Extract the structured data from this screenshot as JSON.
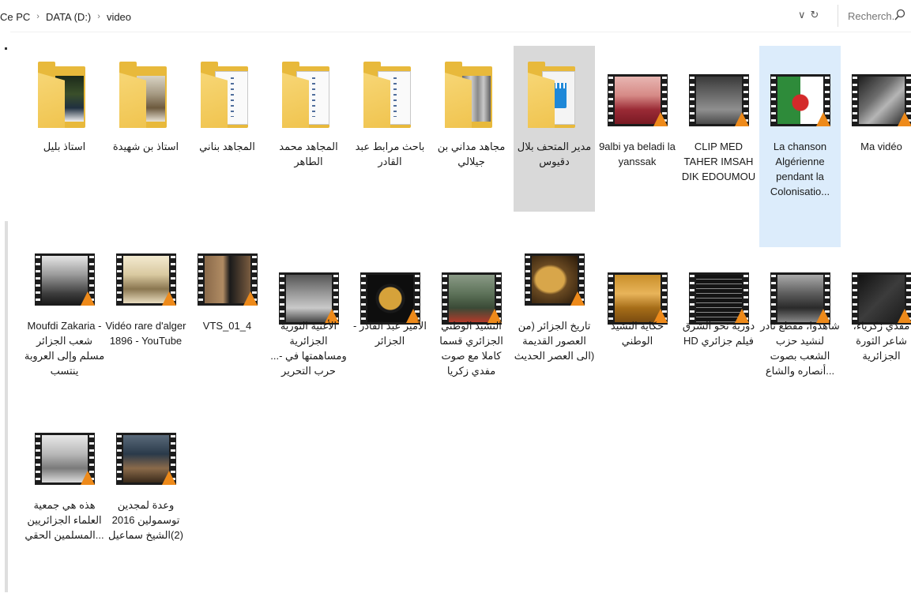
{
  "address": {
    "crumbs": [
      "Ce PC",
      "DATA (D:)",
      "video"
    ],
    "separator": "›",
    "dropdown": "∨",
    "refresh": "↻"
  },
  "search": {
    "placeholder": "Recherch..."
  },
  "items": [
    {
      "label": "استاذ بليل",
      "kind": "folder"
    },
    {
      "label": "استاذ بن شهيدة",
      "kind": "folder"
    },
    {
      "label": "المجاهد بناني",
      "kind": "folder"
    },
    {
      "label": "المجاهد محمد الطاهر",
      "kind": "folder"
    },
    {
      "label": "باحث مرابط عبد القادر",
      "kind": "folder"
    },
    {
      "label": "مجاهد مداني بن جيلالي",
      "kind": "folder"
    },
    {
      "label": "مدير المتحف بلال دقيوس",
      "kind": "folder"
    },
    {
      "label": "9albi ya beladi la yanssak",
      "kind": "video"
    },
    {
      "label": "CLIP MED TAHER IMSAH DIK EDOUMOU",
      "kind": "video"
    },
    {
      "label": "La chanson Algérienne pendant la Colonisatio...",
      "kind": "video"
    },
    {
      "label": "Ma vidéo",
      "kind": "video"
    },
    {
      "label": "Moufdi Zakaria - شعب الجزائر مسلم وإلى العروبة ينتسب",
      "kind": "video"
    },
    {
      "label": "Vidéo rare d'alger 1896 - YouTube",
      "kind": "video"
    },
    {
      "label": "VTS_01_4",
      "kind": "video"
    },
    {
      "label": "الأغنية الثورية الجزائرية ومساهمتها في -... حرب التحرير",
      "kind": "video"
    },
    {
      "label": "- الأمير عبد القادر الجزائر",
      "kind": "video"
    },
    {
      "label": "النشيد الوطني الجزائري قسما كاملا مع صوت مفدي زكريا",
      "kind": "video"
    },
    {
      "label": "تاريخ الجزائر (من العصور القديمة (الى العصر الحديث",
      "kind": "video"
    },
    {
      "label": "حكاية النشيد الوطني",
      "kind": "video"
    },
    {
      "label": "دورية نحو الشرق HD فيلم جزائري",
      "kind": "video"
    },
    {
      "label": "شاهدوا، مقطع نادر لنشيد حزب الشعب بصوت ...أنصاره والشاع",
      "kind": "video"
    },
    {
      "label": "مفدي زكرياء، شاعر الثورة الجزائرية",
      "kind": "video"
    },
    {
      "label": "هذه هي جمعية العلماء الجزائريين ...المسلمين الحقي",
      "kind": "video"
    },
    {
      "label": "وعدة لمجدين توسمولين 2016 (2)الشيخ سماعيل",
      "kind": "video"
    }
  ]
}
